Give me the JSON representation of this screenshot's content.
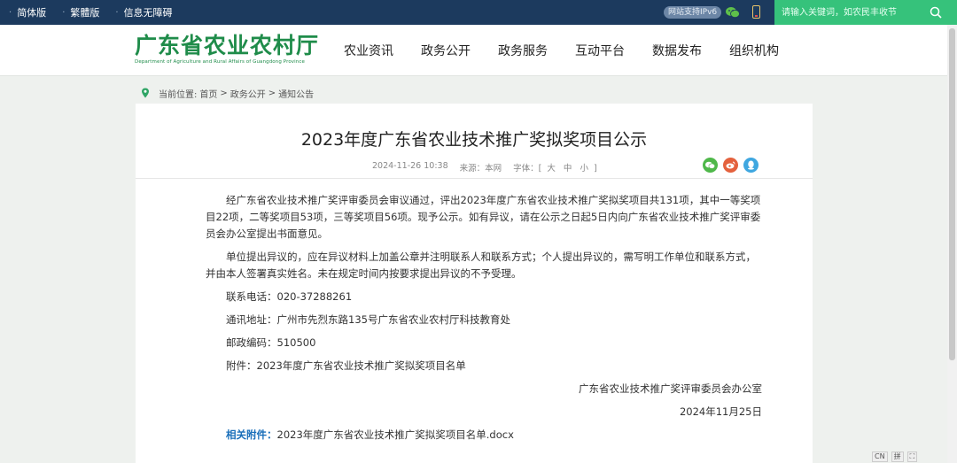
{
  "topbar": {
    "links": [
      "简体版",
      "繁體版",
      "信息无障碍"
    ],
    "ipv6_badge": "网站支持IPv6",
    "search_placeholder": "请输入关键词，如农民丰收节"
  },
  "header": {
    "logo_cn": "广东省农业农村厅",
    "logo_en": "Department of Agriculture and Rural Affairs of Guangdong Province",
    "nav": [
      "农业资讯",
      "政务公开",
      "政务服务",
      "互动平台",
      "数据发布",
      "组织机构"
    ]
  },
  "breadcrumb": {
    "label": "当前位置:",
    "items": [
      "首页",
      "政务公开",
      "通知公告"
    ],
    "separator": ">"
  },
  "article": {
    "title": "2023年度广东省农业技术推广奖拟奖项目公示",
    "date": "2024-11-26 10:38",
    "source": "来源：本网",
    "font_label": "字体：[",
    "font_sizes": [
      "大",
      "中",
      "小"
    ],
    "font_end": "]",
    "paragraphs": [
      "经广东省农业技术推广奖评审委员会审议通过，评出2023年度广东省农业技术推广奖拟奖项目共131项，其中一等奖项目22项，二等奖项目53项，三等奖项目56项。现予公示。如有异议，请在公示之日起5日内向广东省农业技术推广奖评审委员会办公室提出书面意见。",
      "单位提出异议的，应在异议材料上加盖公章并注明联系人和联系方式；个人提出异议的，需写明工作单位和联系方式，并由本人签署真实姓名。未在规定时间内按要求提出异议的不予受理。"
    ],
    "contact_phone": "联系电话：020-37288261",
    "address": "通讯地址：广州市先烈东路135号广东省农业农村厅科技教育处",
    "postcode": "邮政编码：510500",
    "attachment": "附件：2023年度广东省农业技术推广奖拟奖项目名单",
    "signature": "广东省农业技术推广奖评审委员会办公室",
    "sign_date": "2024年11月25日",
    "related_label": "相关附件：",
    "related_file": "2023年度广东省农业技术推广奖拟奖项目名单.docx"
  },
  "tools": [
    "CN",
    "拼",
    "⛶"
  ],
  "colors": {
    "topbar": "#1c3a5e",
    "search": "#36c27b",
    "brand_green": "#1f8c4a",
    "link_blue": "#1a6fba"
  }
}
